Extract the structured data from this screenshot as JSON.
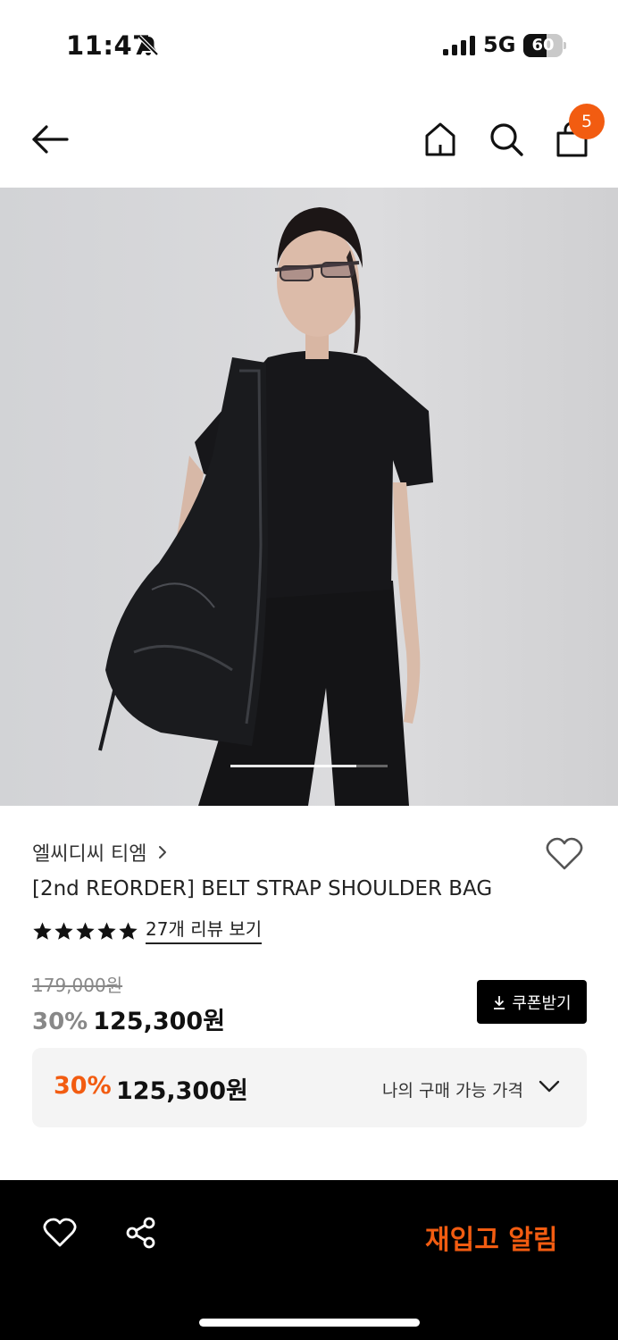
{
  "status_bar": {
    "time": "11:47",
    "network": "5G",
    "battery": "60",
    "battery_level": 0.6
  },
  "header": {
    "cart_count": "5"
  },
  "product": {
    "brand": "엘씨디씨 티엠",
    "title": "[2nd REORDER] BELT STRAP SHOULDER BAG",
    "rating_stars": 5,
    "review_link": "27개 리뷰 보기",
    "original_price": "179,000원",
    "discount_rate": "30%",
    "sale_price": "125,300원",
    "coupon_button": "쿠폰받기",
    "image_carousel_progress": 0.8
  },
  "my_price": {
    "rate": "30%",
    "price": "125,300원",
    "label": "나의 구매 가능 가격"
  },
  "bottom_bar": {
    "restock_button": "재입고 알림"
  },
  "colors": {
    "accent": "#f25c11",
    "button_dark": "#000000"
  }
}
